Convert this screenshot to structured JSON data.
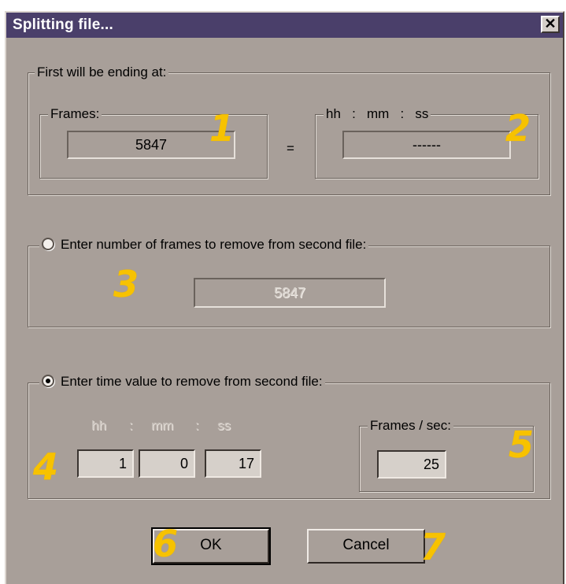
{
  "window": {
    "title": "Splitting file...",
    "close_icon": "close-icon",
    "close_glyph": "✕"
  },
  "first_group": {
    "label": "First will be ending at:",
    "frames_label": "Frames:",
    "frames_value": "5847",
    "equals": "=",
    "time_label": "hh   :   mm   :   ss",
    "time_value": "------"
  },
  "frames_option": {
    "label": "Enter number of frames to remove from second file:",
    "selected": false,
    "value": "5847"
  },
  "time_option": {
    "label": "Enter time value to remove from second file:",
    "selected": true,
    "hh_label": "hh",
    "mm_label": "mm",
    "ss_label": "ss",
    "sep": ":",
    "hh_value": "1",
    "mm_value": "0",
    "ss_value": "17",
    "fps_label": "Frames / sec:",
    "fps_value": "25"
  },
  "buttons": {
    "ok": "OK",
    "cancel": "Cancel"
  },
  "markers": [
    "1",
    "2",
    "3",
    "4",
    "5",
    "6",
    "7"
  ],
  "colors": {
    "titlebar": "#4a3f6a",
    "dialog_bg": "#a89f99",
    "marker": "#f7c200"
  }
}
